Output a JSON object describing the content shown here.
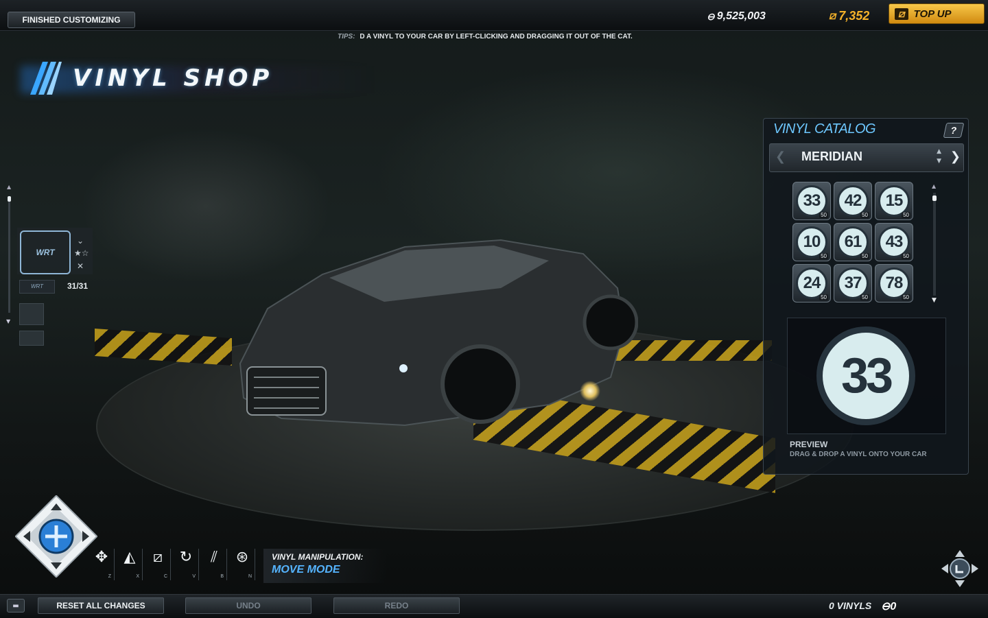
{
  "header": {
    "finished_button": "FINISHED CUSTOMIZING",
    "credits": "9,525,003",
    "boost": "7,352",
    "topup_label": "TOP UP",
    "tips_label": "TIPS:",
    "tips_text": "D A VINYL TO YOUR CAR BY LEFT-CLICKING AND DRAGGING IT OUT OF THE CAT."
  },
  "title": "VINYL SHOP",
  "layers": {
    "count": "31/31",
    "thumb_text": "WRT"
  },
  "catalog": {
    "title": "VINYL CATALOG",
    "help": "?",
    "category": "MERIDIAN",
    "items": [
      {
        "number": "33",
        "cost": "50"
      },
      {
        "number": "42",
        "cost": "50"
      },
      {
        "number": "15",
        "cost": "50"
      },
      {
        "number": "10",
        "cost": "50"
      },
      {
        "number": "61",
        "cost": "50"
      },
      {
        "number": "43",
        "cost": "50"
      },
      {
        "number": "24",
        "cost": "50"
      },
      {
        "number": "37",
        "cost": "50"
      },
      {
        "number": "78",
        "cost": "50"
      }
    ],
    "preview_number": "33",
    "preview_label": "PREVIEW",
    "preview_hint": "DRAG & DROP A VINYL ONTO YOUR CAR"
  },
  "tools": [
    {
      "icon": "move-icon",
      "glyph": "✥",
      "key": "Z"
    },
    {
      "icon": "scale-icon",
      "glyph": "◭",
      "key": "X"
    },
    {
      "icon": "skew-icon",
      "glyph": "⧄",
      "key": "C"
    },
    {
      "icon": "rotate-icon",
      "glyph": "↻",
      "key": "V"
    },
    {
      "icon": "flip-icon",
      "glyph": "⫽",
      "key": "B"
    },
    {
      "icon": "color-icon",
      "glyph": "⊛",
      "key": "N"
    }
  ],
  "manipulation": {
    "label": "VINYL MANIPULATION:",
    "mode": "MOVE MODE"
  },
  "footer": {
    "reset": "RESET ALL CHANGES",
    "undo": "UNDO",
    "redo": "REDO",
    "vinyls": "0 VINYLS",
    "vinyls_cost": "0"
  },
  "colors": {
    "accent_blue": "#55b4ff",
    "boost_orange": "#f5b22a",
    "topup_gold": "#e9a82a"
  }
}
